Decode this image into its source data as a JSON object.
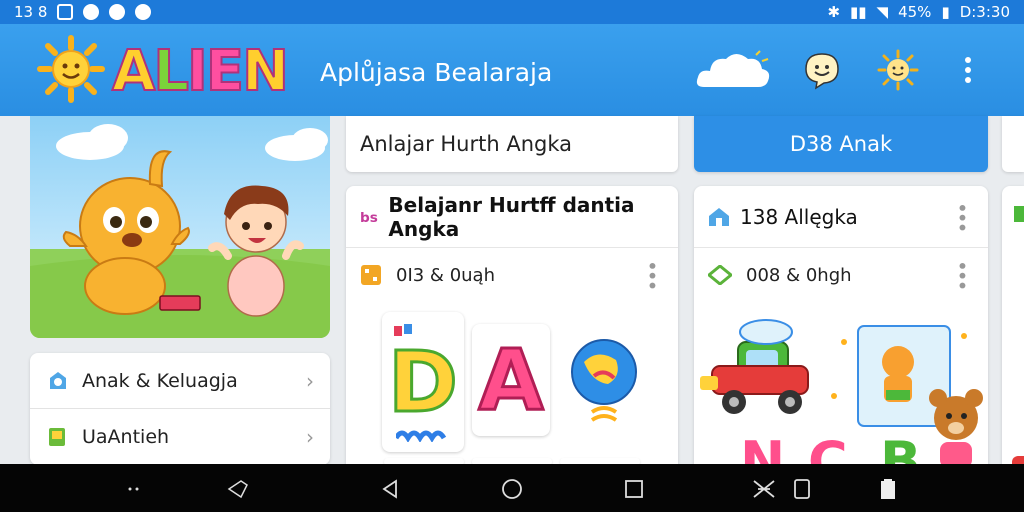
{
  "status_bar": {
    "left_text": "13 8",
    "battery": "45%",
    "time": "D:3:30"
  },
  "app_bar": {
    "logo_letters": [
      "A",
      "L",
      "I",
      "E",
      "N"
    ],
    "logo_colors": [
      "#ffcf2e",
      "#7bd33a",
      "#ff4fa0",
      "#ff4fa0",
      "#ffcf2e"
    ],
    "title": "Aplůjasa Bealaraja",
    "icons": [
      "cloud-icon",
      "smile-bubble-icon",
      "sun-face-icon",
      "more-vert-icon"
    ]
  },
  "sidebar": {
    "items": [
      {
        "label": "Anak & Keluagja",
        "icon": "child-icon"
      },
      {
        "label": "UaAntieh",
        "icon": "book-icon"
      }
    ]
  },
  "tiles": {
    "top_left": "Anlajar Hurth Angka",
    "top_right": "D38 Anak"
  },
  "cards": [
    {
      "title": "Belajanr Hurtff dantia Angka",
      "sub": "0I3 & 0uąh",
      "letters": [
        "D",
        "A"
      ]
    },
    {
      "title": "138 Allęgka",
      "sub": "008 & 0hgh"
    }
  ],
  "colors": {
    "primary": "#2a8ee2",
    "accent": "#2d8fe6"
  }
}
